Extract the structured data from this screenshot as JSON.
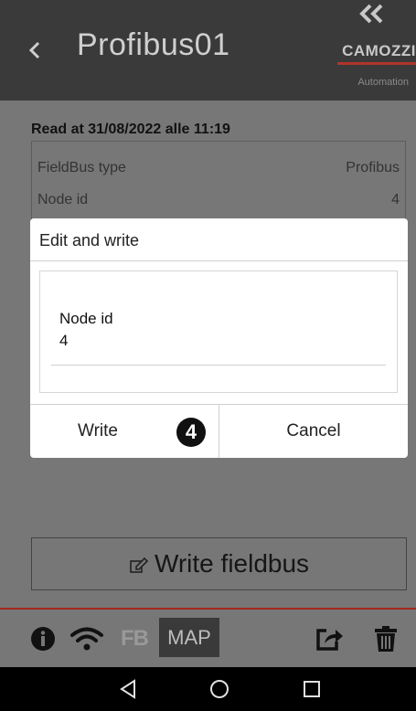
{
  "header": {
    "title": "Profibus01",
    "logo": {
      "brand": "CAMOZZI",
      "subtitle": "Automation"
    }
  },
  "read_info": {
    "label": "Read at 31/08/2022 alle 11:19",
    "rows": [
      {
        "key": "FieldBus type",
        "value": "Profibus"
      },
      {
        "key": "Node id",
        "value": "4"
      }
    ]
  },
  "dialog": {
    "title": "Edit and write",
    "field_label": "Node id",
    "field_value": "4",
    "write_label": "Write",
    "cancel_label": "Cancel",
    "step_badge": "4"
  },
  "write_fieldbus_label": "Write fieldbus",
  "toolbar": {
    "fb_label": "FB",
    "map_label": "MAP"
  },
  "colors": {
    "header_bg": "#3a3a3a",
    "accent_red": "#b0342a",
    "screen_bg": "#777777"
  },
  "icons": [
    "back-chevron-icon",
    "camozzi-logo-icon",
    "edit-icon",
    "info-icon",
    "wifi-icon",
    "share-icon",
    "trash-icon",
    "nav-back-icon",
    "nav-home-icon",
    "nav-recents-icon"
  ]
}
